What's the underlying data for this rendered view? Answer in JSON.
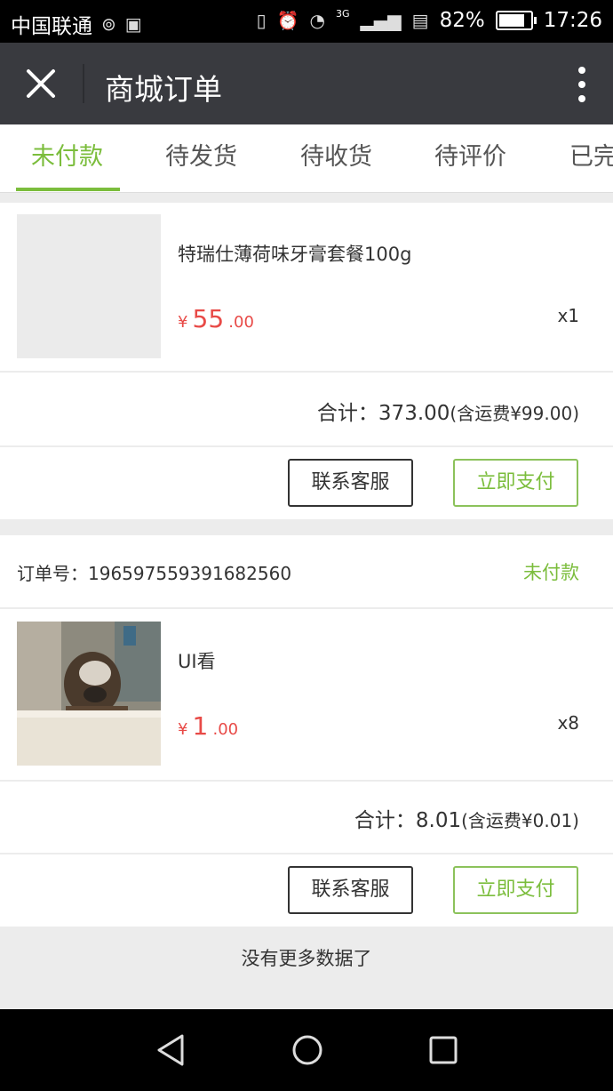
{
  "status_bar": {
    "carrier": "中国联通",
    "network": "3G",
    "battery": "82%",
    "battery_level": 0.82,
    "time": "17:26"
  },
  "title_bar": {
    "title": "商城订单",
    "icons": [
      "close-icon",
      "more-vertical-icon"
    ]
  },
  "tabs": [
    {
      "label": "未付款",
      "active": true
    },
    {
      "label": "待发货",
      "active": false
    },
    {
      "label": "待收货",
      "active": false
    },
    {
      "label": "待评价",
      "active": false
    },
    {
      "label": "已完成",
      "active": false
    }
  ],
  "orders": [
    {
      "item": {
        "name": "特瑞仕薄荷味牙膏套餐100g",
        "price_symbol": "¥",
        "price_int": "55",
        "price_dec": ".00",
        "qty": "x1"
      },
      "total_label": "合计：",
      "total_value": "373.00",
      "total_shipping": "(含运费¥99.00)",
      "buttons": {
        "contact": "联系客服",
        "pay": "立即支付"
      }
    },
    {
      "order_no_label": "订单号：",
      "order_no": "196597559391682560",
      "status": "未付款",
      "item": {
        "name": "UI看",
        "price_symbol": "¥",
        "price_int": "1",
        "price_dec": ".00",
        "qty": "x8"
      },
      "total_label": "合计：",
      "total_value": "8.01",
      "total_shipping": "(含运费¥0.01)",
      "buttons": {
        "contact": "联系客服",
        "pay": "立即支付"
      }
    }
  ],
  "footer_text": "没有更多数据了",
  "nav_bar": {
    "icons": [
      "back-icon",
      "home-icon",
      "recents-icon"
    ]
  },
  "colors": {
    "accent": "#7bbd3c",
    "price": "#e84a47",
    "title_bar": "#393a3f"
  }
}
